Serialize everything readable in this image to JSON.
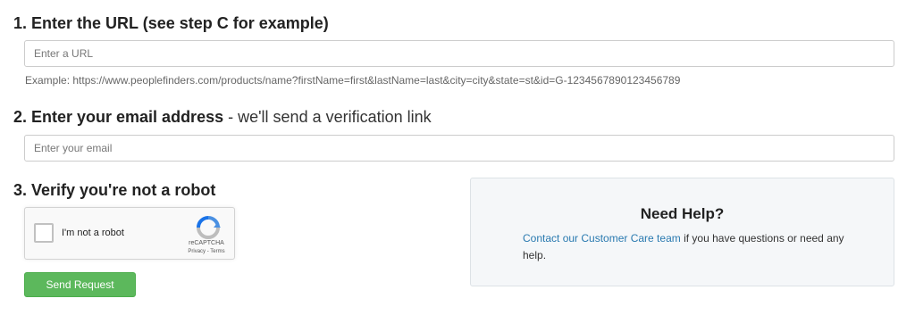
{
  "step1": {
    "heading": "1. Enter the URL (see step C for example)",
    "url_placeholder": "Enter a URL",
    "example": "Example: https://www.peoplefinders.com/products/name?firstName=first&lastName=last&city=city&state=st&id=G-1234567890123456789"
  },
  "step2": {
    "heading_bold": "2. Enter your email address",
    "heading_rest": " - we'll send a verification link",
    "email_placeholder": "Enter your email"
  },
  "step3": {
    "heading": "3. Verify you're not a robot"
  },
  "recaptcha": {
    "label": "I'm not a robot",
    "brand": "reCAPTCHA",
    "links": "Privacy - Terms",
    "checked": false
  },
  "send_button": {
    "label": "Send Request"
  },
  "help": {
    "title": "Need Help?",
    "link_text": "Contact our Customer Care team",
    "body_text": " if you have questions or need any help."
  },
  "colors": {
    "button_green": "#5cb85c",
    "link_blue": "#2a7ab0",
    "help_bg": "#f5f7f9"
  }
}
